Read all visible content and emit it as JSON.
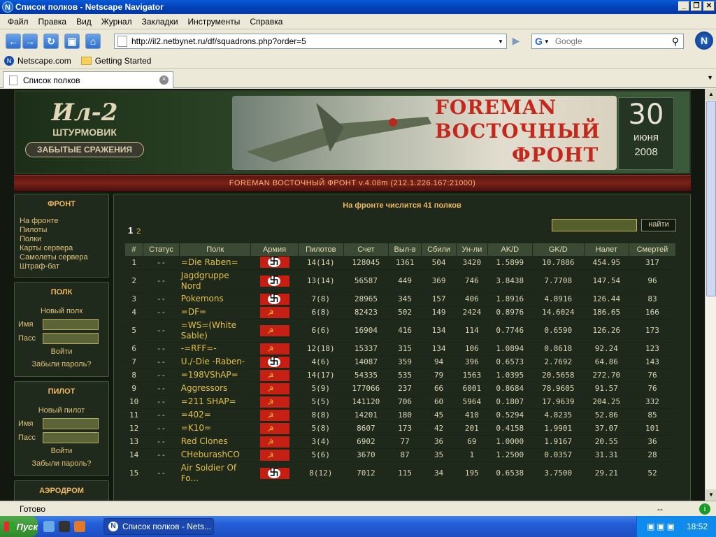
{
  "window": {
    "title": "Список полков - Netscape Navigator"
  },
  "menu": [
    "Файл",
    "Правка",
    "Вид",
    "Журнал",
    "Закладки",
    "Инструменты",
    "Справка"
  ],
  "nav": {
    "url": "http://il2.netbynet.ru/df/squadrons.php?order=5",
    "search_placeholder": "Google"
  },
  "bookmarks": [
    "Netscape.com",
    "Getting Started"
  ],
  "tab": {
    "title": "Список полков"
  },
  "banner": {
    "logo_big": "Ил-2",
    "logo_mid": "ШТУРМОВИК",
    "logo_plate": "ЗАБЫТЫЕ СРАЖЕНИЯ",
    "title_lines": [
      "FOREMAN",
      "ВОСТОЧНЫЙ",
      "ФРОНТ"
    ],
    "date_day": "30",
    "date_month": "июня",
    "date_year": "2008"
  },
  "server_line": "FOREMAN ВОСТОЧНЫЙ ФРОНТ v.4.08m (212.1.226.167:21000)",
  "sidebar": {
    "front_title": "ФРОНТ",
    "front_links": [
      "На фронте",
      "Пилоты",
      "Полки",
      "Карты сервера",
      "Самолеты сервера",
      "Штраф-бат"
    ],
    "squad_title": "ПОЛК",
    "squad_new": "Новый полк",
    "name_label": "Имя",
    "pass_label": "Пасс",
    "login": "Войти",
    "forgot": "Забыли пароль?",
    "pilot_title": "ПИЛОТ",
    "pilot_new": "Новый пилот",
    "airfield_title": "АЭРОДРОМ"
  },
  "main": {
    "title": "На фронте числится 41 полков",
    "page_current": "1",
    "page_other": "2",
    "search_button": "найти",
    "columns": [
      "#",
      "Статус",
      "Полк",
      "Армия",
      "Пилотов",
      "Счет",
      "Выл-в",
      "Сбили",
      "Ун-ли",
      "AK/D",
      "GK/D",
      "Налет",
      "Смертей"
    ],
    "rows": [
      {
        "n": "1",
        "status": "--",
        "name": "=Die Raben=",
        "army": "de",
        "pilots": "14(14)",
        "score": "128045",
        "sorties": "1361",
        "shot": "504",
        "killed": "3420",
        "akd": "1.5899",
        "gkd": "10.7886",
        "hours": "454.95",
        "deaths": "317"
      },
      {
        "n": "2",
        "status": "--",
        "name": "Jagdgruppe Nord",
        "army": "de",
        "pilots": "13(14)",
        "score": "56587",
        "sorties": "449",
        "shot": "369",
        "killed": "746",
        "akd": "3.8438",
        "gkd": "7.7708",
        "hours": "147.54",
        "deaths": "96"
      },
      {
        "n": "3",
        "status": "--",
        "name": "Pokemons",
        "army": "de",
        "pilots": "7(8)",
        "score": "28965",
        "sorties": "345",
        "shot": "157",
        "killed": "406",
        "akd": "1.8916",
        "gkd": "4.8916",
        "hours": "126.44",
        "deaths": "83"
      },
      {
        "n": "4",
        "status": "--",
        "name": "=DF=",
        "army": "su",
        "pilots": "6(8)",
        "score": "82423",
        "sorties": "502",
        "shot": "149",
        "killed": "2424",
        "akd": "0.8976",
        "gkd": "14.6024",
        "hours": "186.65",
        "deaths": "166"
      },
      {
        "n": "5",
        "status": "--",
        "name": "=WS=(White Sable)",
        "army": "su",
        "pilots": "6(6)",
        "score": "16904",
        "sorties": "416",
        "shot": "134",
        "killed": "114",
        "akd": "0.7746",
        "gkd": "0.6590",
        "hours": "126.26",
        "deaths": "173"
      },
      {
        "n": "6",
        "status": "--",
        "name": "-=RFF=-",
        "army": "su",
        "pilots": "12(18)",
        "score": "15337",
        "sorties": "315",
        "shot": "134",
        "killed": "106",
        "akd": "1.0894",
        "gkd": "0.8618",
        "hours": "92.24",
        "deaths": "123"
      },
      {
        "n": "7",
        "status": "--",
        "name": "U./-Die -Raben-",
        "army": "de",
        "pilots": "4(6)",
        "score": "14087",
        "sorties": "359",
        "shot": "94",
        "killed": "396",
        "akd": "0.6573",
        "gkd": "2.7692",
        "hours": "64.86",
        "deaths": "143"
      },
      {
        "n": "8",
        "status": "--",
        "name": "=198VShAP=",
        "army": "su",
        "pilots": "14(17)",
        "score": "54335",
        "sorties": "535",
        "shot": "79",
        "killed": "1563",
        "akd": "1.0395",
        "gkd": "20.5658",
        "hours": "272.70",
        "deaths": "76"
      },
      {
        "n": "9",
        "status": "--",
        "name": "Aggressors",
        "army": "su",
        "pilots": "5(9)",
        "score": "177066",
        "sorties": "237",
        "shot": "66",
        "killed": "6001",
        "akd": "0.8684",
        "gkd": "78.9605",
        "hours": "91.57",
        "deaths": "76"
      },
      {
        "n": "10",
        "status": "--",
        "name": "=211 SHAP=",
        "army": "su",
        "pilots": "5(5)",
        "score": "141120",
        "sorties": "706",
        "shot": "60",
        "killed": "5964",
        "akd": "0.1807",
        "gkd": "17.9639",
        "hours": "204.25",
        "deaths": "332"
      },
      {
        "n": "11",
        "status": "--",
        "name": "=402=",
        "army": "su",
        "pilots": "8(8)",
        "score": "14201",
        "sorties": "180",
        "shot": "45",
        "killed": "410",
        "akd": "0.5294",
        "gkd": "4.8235",
        "hours": "52.86",
        "deaths": "85"
      },
      {
        "n": "12",
        "status": "--",
        "name": "=K10=",
        "army": "su",
        "pilots": "5(8)",
        "score": "8607",
        "sorties": "173",
        "shot": "42",
        "killed": "201",
        "akd": "0.4158",
        "gkd": "1.9901",
        "hours": "37.07",
        "deaths": "101"
      },
      {
        "n": "13",
        "status": "--",
        "name": "Red Clones",
        "army": "su",
        "pilots": "3(4)",
        "score": "6902",
        "sorties": "77",
        "shot": "36",
        "killed": "69",
        "akd": "1.0000",
        "gkd": "1.9167",
        "hours": "20.55",
        "deaths": "36"
      },
      {
        "n": "14",
        "status": "--",
        "name": "CHeburashCO",
        "army": "su",
        "pilots": "5(6)",
        "score": "3670",
        "sorties": "87",
        "shot": "35",
        "killed": "1",
        "akd": "1.2500",
        "gkd": "0.0357",
        "hours": "31.31",
        "deaths": "28"
      },
      {
        "n": "15",
        "status": "--",
        "name": "Air Soldier Of Fo...",
        "army": "de",
        "pilots": "8(12)",
        "score": "7012",
        "sorties": "115",
        "shot": "34",
        "killed": "195",
        "akd": "0.6538",
        "gkd": "3.7500",
        "hours": "29.21",
        "deaths": "52"
      }
    ]
  },
  "status": {
    "text": "Готово",
    "right": "--"
  },
  "taskbar": {
    "start": "Пуск",
    "item": "Список полков - Nets...",
    "clock": "18:52"
  }
}
